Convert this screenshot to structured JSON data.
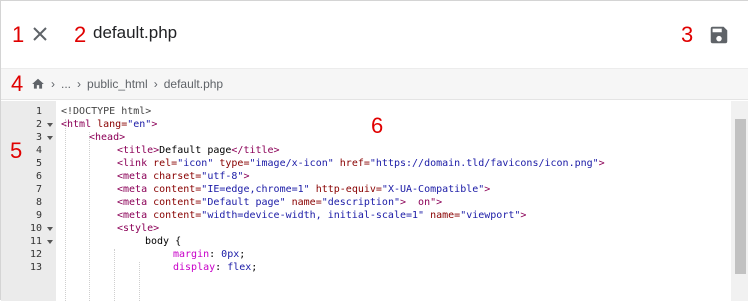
{
  "annotations": [
    "1",
    "2",
    "3",
    "4",
    "5",
    "6"
  ],
  "header": {
    "close_icon": "close-icon",
    "file_name": "default.php",
    "save_icon": "floppy-disk-icon"
  },
  "breadcrumb": {
    "home_icon": "home-icon",
    "items": [
      "...",
      "public_html",
      "default.php"
    ]
  },
  "editor": {
    "line_numbers": [
      "1",
      "2",
      "3",
      "4",
      "5",
      "6",
      "7",
      "8",
      "9",
      "10",
      "11",
      "12",
      "13"
    ],
    "fold_lines": [
      "2",
      "3",
      "10",
      "11"
    ],
    "lines": [
      [
        {
          "t": "<!DOCTYPE html>",
          "c": "doctype"
        }
      ],
      [
        {
          "t": "<html ",
          "c": "tag"
        },
        {
          "t": "lang=",
          "c": "attr"
        },
        {
          "t": "\"en\"",
          "c": "str"
        },
        {
          "t": ">",
          "c": "tag"
        }
      ],
      [
        {
          "t": "<head>",
          "c": "tag"
        }
      ],
      [
        {
          "t": "<title>",
          "c": "tag"
        },
        {
          "t": "Default page",
          "c": "txt"
        },
        {
          "t": "</title>",
          "c": "tag"
        }
      ],
      [
        {
          "t": "<link ",
          "c": "tag"
        },
        {
          "t": "rel=",
          "c": "attr"
        },
        {
          "t": "\"icon\"",
          "c": "str"
        },
        {
          "t": " type=",
          "c": "attr"
        },
        {
          "t": "\"image/x-icon\"",
          "c": "str"
        },
        {
          "t": " href=",
          "c": "attr"
        },
        {
          "t": "\"https://domain.tld/favicons/icon.png\"",
          "c": "str"
        },
        {
          "t": ">",
          "c": "tag"
        }
      ],
      [
        {
          "t": "<meta ",
          "c": "tag"
        },
        {
          "t": "charset=",
          "c": "attr"
        },
        {
          "t": "\"utf-8\"",
          "c": "str"
        },
        {
          "t": ">",
          "c": "tag"
        }
      ],
      [
        {
          "t": "<meta ",
          "c": "tag"
        },
        {
          "t": "content=",
          "c": "attr"
        },
        {
          "t": "\"IE=edge,chrome=1\"",
          "c": "str"
        },
        {
          "t": " http-equiv=",
          "c": "attr"
        },
        {
          "t": "\"X-UA-Compatible\"",
          "c": "str"
        },
        {
          "t": ">",
          "c": "tag"
        }
      ],
      [
        {
          "t": "<meta ",
          "c": "tag"
        },
        {
          "t": "content=",
          "c": "attr"
        },
        {
          "t": "\"Default page\"",
          "c": "str"
        },
        {
          "t": " name=",
          "c": "attr"
        },
        {
          "t": "\"description\"",
          "c": "str"
        },
        {
          "t": ">  on\">",
          "c": "tag"
        }
      ],
      [
        {
          "t": "<meta ",
          "c": "tag"
        },
        {
          "t": "content=",
          "c": "attr"
        },
        {
          "t": "\"width=device-width, initial-scale=1\"",
          "c": "str"
        },
        {
          "t": " name=",
          "c": "attr"
        },
        {
          "t": "\"viewport\"",
          "c": "str"
        },
        {
          "t": ">",
          "c": "tag"
        }
      ],
      [
        {
          "t": "<style>",
          "c": "tag"
        }
      ],
      [
        {
          "t": "body {",
          "c": "txt"
        }
      ],
      [
        {
          "t": "margin",
          "c": "prop"
        },
        {
          "t": ": ",
          "c": "txt"
        },
        {
          "t": "0px",
          "c": "num"
        },
        {
          "t": ";",
          "c": "txt"
        }
      ],
      [
        {
          "t": "display",
          "c": "prop"
        },
        {
          "t": ": ",
          "c": "txt"
        },
        {
          "t": "flex",
          "c": "num"
        },
        {
          "t": ";",
          "c": "txt"
        }
      ]
    ]
  }
}
